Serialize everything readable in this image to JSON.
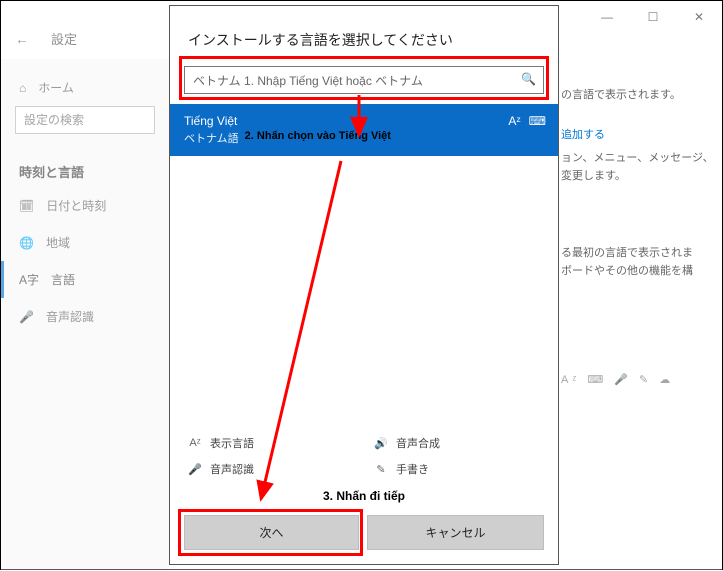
{
  "titlebar": {
    "min": "—",
    "max": "☐",
    "close": "✕"
  },
  "app": {
    "back": "←",
    "title": "設定"
  },
  "sidebar": {
    "home_icon": "⌂",
    "home": "ホーム",
    "search_placeholder": "設定の検索",
    "section": "時刻と言語",
    "items": [
      {
        "icon": "🗓",
        "label": "日付と時刻"
      },
      {
        "icon": "🌐",
        "label": "地域"
      },
      {
        "icon": "A字",
        "label": "言語"
      },
      {
        "icon": "🎤",
        "label": "音声認識"
      }
    ]
  },
  "dialog": {
    "title": "インストールする言語を選択してください",
    "search_text": "ベトナム 1. Nhập Tiếng Việt hoặc ベトナム",
    "search_icon": "🔍",
    "selected_lang": {
      "primary": "Tiếng Việt",
      "secondary": "ベトナム語",
      "annot": "2. Nhấn chọn vào Tiếng Việt",
      "icon_a": "Aᶻ",
      "icon_b": "⌨"
    },
    "legend": {
      "display_icon": "Aᶻ",
      "display": "表示言語",
      "tts_icon": "🔊",
      "tts": "音声合成",
      "sr_icon": "🎤",
      "sr": "音声認識",
      "hw_icon": "✎",
      "hw": "手書き"
    },
    "annot3": "3. Nhấn đi tiếp",
    "next": "次へ",
    "cancel": "キャンセル"
  },
  "right": {
    "line1": "の言語で表示されます。",
    "add": "追加する",
    "line2": "ョン、メニュー、メッセージ、",
    "line3": "変更します。",
    "line4": "る最初の言語で表示されま",
    "line5": "ボードやその他の機能を構"
  },
  "small_icons": "Aᶻ ⌨ 🎤 ✎ ☁"
}
